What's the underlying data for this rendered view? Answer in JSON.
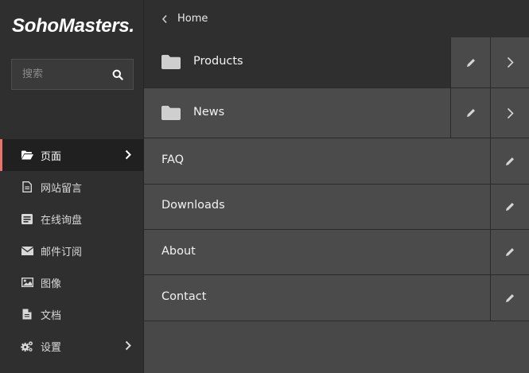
{
  "brand": {
    "logo_text": "SohoMasters."
  },
  "search": {
    "placeholder": "搜索"
  },
  "sidebar": {
    "items": [
      {
        "label": "页面",
        "icon": "folder-open-icon",
        "active": true,
        "has_chevron": true
      },
      {
        "label": "网站留言",
        "icon": "file-text-icon",
        "active": false,
        "has_chevron": false
      },
      {
        "label": "在线询盘",
        "icon": "list-alt-icon",
        "active": false,
        "has_chevron": false
      },
      {
        "label": "邮件订阅",
        "icon": "envelope-icon",
        "active": false,
        "has_chevron": false
      },
      {
        "label": "图像",
        "icon": "image-icon",
        "active": false,
        "has_chevron": false
      },
      {
        "label": "文档",
        "icon": "file-icon",
        "active": false,
        "has_chevron": false
      },
      {
        "label": "设置",
        "icon": "cogs-icon",
        "active": false,
        "has_chevron": true
      }
    ]
  },
  "breadcrumb": {
    "label": "Home"
  },
  "pages": [
    {
      "label": "Products",
      "type": "folder",
      "selected": true
    },
    {
      "label": "News",
      "type": "folder",
      "selected": false
    },
    {
      "label": "FAQ",
      "type": "page",
      "selected": false
    },
    {
      "label": "Downloads",
      "type": "page",
      "selected": false
    },
    {
      "label": "About",
      "type": "page",
      "selected": false
    },
    {
      "label": "Contact",
      "type": "page",
      "selected": false
    }
  ],
  "colors": {
    "sidebar_bg": "#2f2f2f",
    "sidebar_active_bg": "#202020",
    "active_accent": "#e8736b",
    "main_bg": "#484848",
    "row_selected_bg": "#2f2f2f",
    "row_bg": "#4b4b4b"
  }
}
